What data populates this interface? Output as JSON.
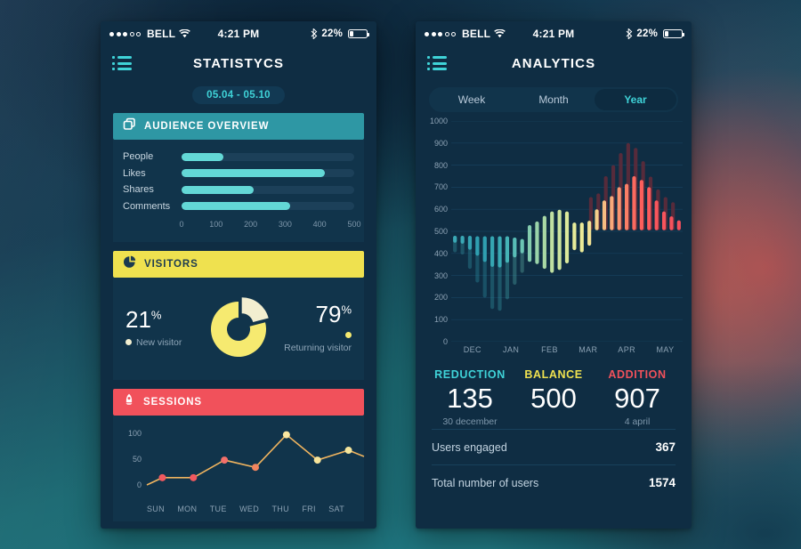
{
  "statusbar": {
    "carrier": "BELL",
    "time": "4:21 PM",
    "battery_pct": "22%",
    "signal_dots_filled": 3,
    "signal_dots_total": 5
  },
  "left_phone": {
    "nav_title": "STATISTYCS",
    "menu_icon": "hamburger-list-icon",
    "date_range": "05.04 - 05.10",
    "audience": {
      "header": "AUDIENCE OVERVIEW",
      "icon": "copy-layers-icon",
      "accent": "#2e97a4"
    },
    "visitors": {
      "header": "VISITORS",
      "icon": "pie-chart-icon",
      "accent": "#efe14f",
      "new_pct": "21",
      "new_label": "New visitor",
      "new_color": "#f2eed0",
      "returning_pct": "79",
      "returning_label": "Returning visitor",
      "returning_color": "#f6ea70",
      "pct_symbol": "%"
    },
    "sessions": {
      "header": "SESSIONS",
      "icon": "rocket-icon",
      "accent": "#f1515b"
    }
  },
  "right_phone": {
    "nav_title": "ANALYTICS",
    "menu_icon": "hamburger-list-icon",
    "segments": [
      {
        "label": "Week",
        "active": false
      },
      {
        "label": "Month",
        "active": false
      },
      {
        "label": "Year",
        "active": true
      }
    ],
    "stats": [
      {
        "title": "REDUCTION",
        "value": "135",
        "sub": "30 december",
        "color": "#3fd3d8"
      },
      {
        "title": "BALANCE",
        "value": "500",
        "sub": "",
        "color": "#efe14f"
      },
      {
        "title": "ADDITION",
        "value": "907",
        "sub": "4 april",
        "color": "#f1515b"
      }
    ],
    "rows": [
      {
        "key": "Users engaged",
        "value": "367"
      },
      {
        "key": "Total number of users",
        "value": "1574"
      }
    ]
  },
  "chart_data": [
    {
      "type": "bar",
      "orientation": "horizontal",
      "title": "Audience Overview",
      "categories": [
        "People",
        "Likes",
        "Shares",
        "Comments"
      ],
      "values": [
        120,
        415,
        210,
        315
      ],
      "ticks": [
        0,
        100,
        200,
        300,
        400,
        500
      ],
      "xlim": [
        0,
        500
      ],
      "xlabel": "",
      "ylabel": "",
      "grid": false,
      "bar_color": "#63d8d6",
      "track_color": "#1c4059"
    },
    {
      "type": "pie",
      "title": "Visitors",
      "labels": [
        "New visitor",
        "Returning visitor"
      ],
      "values": [
        21,
        79
      ],
      "colors": [
        "#f2eed0",
        "#f6ea70"
      ],
      "donut": true,
      "exploded_slice": 0,
      "legend": "sides"
    },
    {
      "type": "line",
      "title": "Sessions",
      "categories": [
        "SUN",
        "MON",
        "TUE",
        "WED",
        "THU",
        "FRI",
        "SAT"
      ],
      "values": [
        14,
        14,
        48,
        34,
        97,
        48,
        67
      ],
      "yticks": [
        0,
        50,
        100
      ],
      "ylim": [
        0,
        110
      ],
      "xlabel": "",
      "ylabel": "",
      "grid": false,
      "point_colors": [
        "#f1595f",
        "#f1595f",
        "#f4706a",
        "#f2855f",
        "#fbe7a0",
        "#f8e49a",
        "#f5e59c"
      ],
      "line_color": "#f0b45f"
    },
    {
      "type": "bar",
      "variant": "floating-range",
      "title": "Analytics Year",
      "categories": [
        "DEC",
        "JAN",
        "FEB",
        "MAR",
        "APR",
        "MAY"
      ],
      "yticks": [
        0,
        100,
        200,
        300,
        400,
        500,
        600,
        700,
        800,
        900,
        1000
      ],
      "ylim": [
        0,
        1000
      ],
      "baseline": 500,
      "xlabel": "",
      "ylabel": "",
      "grid": true,
      "bars": [
        {
          "high": 480,
          "low": 405,
          "color": "#3aa8b5"
        },
        {
          "high": 480,
          "low": 395,
          "color": "#3aa8b5"
        },
        {
          "high": 480,
          "low": 330,
          "color": "#34a3b2"
        },
        {
          "high": 478,
          "low": 268,
          "color": "#2f9fb0"
        },
        {
          "high": 478,
          "low": 200,
          "color": "#2f9fb0"
        },
        {
          "high": 478,
          "low": 148,
          "color": "#35a6b2"
        },
        {
          "high": 478,
          "low": 140,
          "color": "#3aabb4"
        },
        {
          "high": 478,
          "low": 192,
          "color": "#45b3b6"
        },
        {
          "high": 472,
          "low": 258,
          "color": "#58bdb7"
        },
        {
          "high": 465,
          "low": 312,
          "color": "#6bc5b4"
        },
        {
          "high": 528,
          "low": 362,
          "color": "#84ccae"
        },
        {
          "high": 545,
          "low": 352,
          "color": "#9ad3a9"
        },
        {
          "high": 570,
          "low": 330,
          "color": "#a9d8a4"
        },
        {
          "high": 590,
          "low": 312,
          "color": "#bfe0a1"
        },
        {
          "high": 598,
          "low": 325,
          "color": "#cde59e"
        },
        {
          "high": 590,
          "low": 355,
          "color": "#dbe99b"
        },
        {
          "high": 540,
          "low": 415,
          "color": "#e6ec9a"
        },
        {
          "high": 540,
          "low": 405,
          "color": "#eceb98"
        },
        {
          "high": 548,
          "low": 435,
          "color": "#f2e294"
        },
        {
          "high": 600,
          "low": 505,
          "color": "#f6cf8a"
        },
        {
          "high": 640,
          "low": 505,
          "color": "#f7bd82"
        },
        {
          "high": 660,
          "low": 505,
          "color": "#f8a97a"
        },
        {
          "high": 700,
          "low": 505,
          "color": "#f9936f"
        },
        {
          "high": 715,
          "low": 505,
          "color": "#fa7e66"
        },
        {
          "high": 750,
          "low": 505,
          "color": "#fb6a5f"
        },
        {
          "high": 733,
          "low": 505,
          "color": "#fb5f5c"
        },
        {
          "high": 700,
          "low": 505,
          "color": "#fa5a5c"
        },
        {
          "high": 640,
          "low": 505,
          "color": "#f9565c"
        },
        {
          "high": 590,
          "low": 505,
          "color": "#f8545c"
        },
        {
          "high": 568,
          "low": 505,
          "color": "#f7525c"
        },
        {
          "high": 550,
          "low": 505,
          "color": "#f6505c"
        }
      ],
      "shadow_bars": [
        {
          "high": 655,
          "low": 505
        },
        {
          "high": 672,
          "low": 505
        },
        {
          "high": 750,
          "low": 505
        },
        {
          "high": 800,
          "low": 505
        },
        {
          "high": 855,
          "low": 505
        },
        {
          "high": 900,
          "low": 505
        },
        {
          "high": 878,
          "low": 505
        },
        {
          "high": 818,
          "low": 505
        },
        {
          "high": 748,
          "low": 505
        },
        {
          "high": 690,
          "low": 505
        },
        {
          "high": 655,
          "low": 505
        },
        {
          "high": 632,
          "low": 505
        }
      ]
    }
  ]
}
